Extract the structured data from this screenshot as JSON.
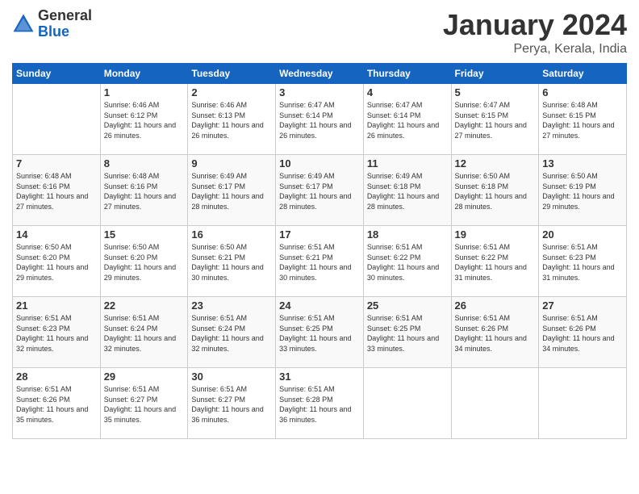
{
  "header": {
    "logo": {
      "general": "General",
      "blue": "Blue"
    },
    "title": "January 2024",
    "subtitle": "Perya, Kerala, India"
  },
  "days_of_week": [
    "Sunday",
    "Monday",
    "Tuesday",
    "Wednesday",
    "Thursday",
    "Friday",
    "Saturday"
  ],
  "weeks": [
    [
      {
        "day": "",
        "sunrise": "",
        "sunset": "",
        "daylight": ""
      },
      {
        "day": "1",
        "sunrise": "6:46 AM",
        "sunset": "6:12 PM",
        "daylight": "11 hours and 26 minutes."
      },
      {
        "day": "2",
        "sunrise": "6:46 AM",
        "sunset": "6:13 PM",
        "daylight": "11 hours and 26 minutes."
      },
      {
        "day": "3",
        "sunrise": "6:47 AM",
        "sunset": "6:14 PM",
        "daylight": "11 hours and 26 minutes."
      },
      {
        "day": "4",
        "sunrise": "6:47 AM",
        "sunset": "6:14 PM",
        "daylight": "11 hours and 26 minutes."
      },
      {
        "day": "5",
        "sunrise": "6:47 AM",
        "sunset": "6:15 PM",
        "daylight": "11 hours and 27 minutes."
      },
      {
        "day": "6",
        "sunrise": "6:48 AM",
        "sunset": "6:15 PM",
        "daylight": "11 hours and 27 minutes."
      }
    ],
    [
      {
        "day": "7",
        "sunrise": "6:48 AM",
        "sunset": "6:16 PM",
        "daylight": "11 hours and 27 minutes."
      },
      {
        "day": "8",
        "sunrise": "6:48 AM",
        "sunset": "6:16 PM",
        "daylight": "11 hours and 27 minutes."
      },
      {
        "day": "9",
        "sunrise": "6:49 AM",
        "sunset": "6:17 PM",
        "daylight": "11 hours and 28 minutes."
      },
      {
        "day": "10",
        "sunrise": "6:49 AM",
        "sunset": "6:17 PM",
        "daylight": "11 hours and 28 minutes."
      },
      {
        "day": "11",
        "sunrise": "6:49 AM",
        "sunset": "6:18 PM",
        "daylight": "11 hours and 28 minutes."
      },
      {
        "day": "12",
        "sunrise": "6:50 AM",
        "sunset": "6:18 PM",
        "daylight": "11 hours and 28 minutes."
      },
      {
        "day": "13",
        "sunrise": "6:50 AM",
        "sunset": "6:19 PM",
        "daylight": "11 hours and 29 minutes."
      }
    ],
    [
      {
        "day": "14",
        "sunrise": "6:50 AM",
        "sunset": "6:20 PM",
        "daylight": "11 hours and 29 minutes."
      },
      {
        "day": "15",
        "sunrise": "6:50 AM",
        "sunset": "6:20 PM",
        "daylight": "11 hours and 29 minutes."
      },
      {
        "day": "16",
        "sunrise": "6:50 AM",
        "sunset": "6:21 PM",
        "daylight": "11 hours and 30 minutes."
      },
      {
        "day": "17",
        "sunrise": "6:51 AM",
        "sunset": "6:21 PM",
        "daylight": "11 hours and 30 minutes."
      },
      {
        "day": "18",
        "sunrise": "6:51 AM",
        "sunset": "6:22 PM",
        "daylight": "11 hours and 30 minutes."
      },
      {
        "day": "19",
        "sunrise": "6:51 AM",
        "sunset": "6:22 PM",
        "daylight": "11 hours and 31 minutes."
      },
      {
        "day": "20",
        "sunrise": "6:51 AM",
        "sunset": "6:23 PM",
        "daylight": "11 hours and 31 minutes."
      }
    ],
    [
      {
        "day": "21",
        "sunrise": "6:51 AM",
        "sunset": "6:23 PM",
        "daylight": "11 hours and 32 minutes."
      },
      {
        "day": "22",
        "sunrise": "6:51 AM",
        "sunset": "6:24 PM",
        "daylight": "11 hours and 32 minutes."
      },
      {
        "day": "23",
        "sunrise": "6:51 AM",
        "sunset": "6:24 PM",
        "daylight": "11 hours and 32 minutes."
      },
      {
        "day": "24",
        "sunrise": "6:51 AM",
        "sunset": "6:25 PM",
        "daylight": "11 hours and 33 minutes."
      },
      {
        "day": "25",
        "sunrise": "6:51 AM",
        "sunset": "6:25 PM",
        "daylight": "11 hours and 33 minutes."
      },
      {
        "day": "26",
        "sunrise": "6:51 AM",
        "sunset": "6:26 PM",
        "daylight": "11 hours and 34 minutes."
      },
      {
        "day": "27",
        "sunrise": "6:51 AM",
        "sunset": "6:26 PM",
        "daylight": "11 hours and 34 minutes."
      }
    ],
    [
      {
        "day": "28",
        "sunrise": "6:51 AM",
        "sunset": "6:26 PM",
        "daylight": "11 hours and 35 minutes."
      },
      {
        "day": "29",
        "sunrise": "6:51 AM",
        "sunset": "6:27 PM",
        "daylight": "11 hours and 35 minutes."
      },
      {
        "day": "30",
        "sunrise": "6:51 AM",
        "sunset": "6:27 PM",
        "daylight": "11 hours and 36 minutes."
      },
      {
        "day": "31",
        "sunrise": "6:51 AM",
        "sunset": "6:28 PM",
        "daylight": "11 hours and 36 minutes."
      },
      {
        "day": "",
        "sunrise": "",
        "sunset": "",
        "daylight": ""
      },
      {
        "day": "",
        "sunrise": "",
        "sunset": "",
        "daylight": ""
      },
      {
        "day": "",
        "sunrise": "",
        "sunset": "",
        "daylight": ""
      }
    ]
  ]
}
